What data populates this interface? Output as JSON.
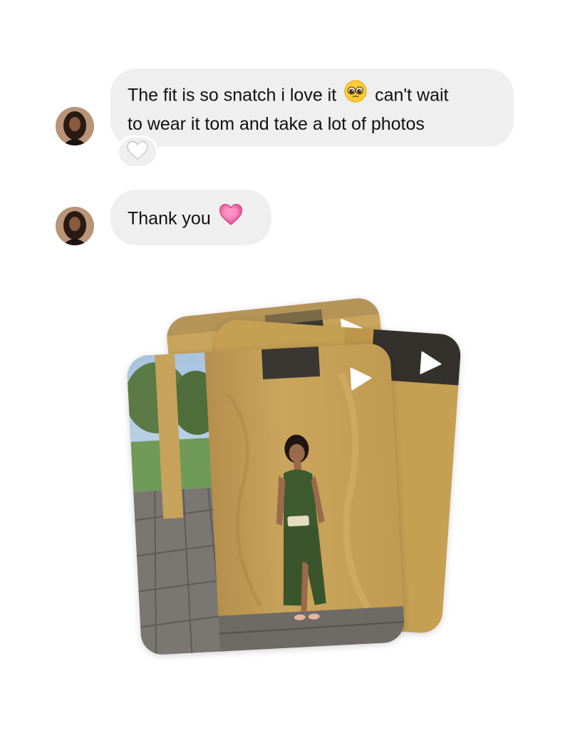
{
  "thread": {
    "messages": [
      {
        "sender": "contact",
        "line1_before_emoji": "The fit is so snatch i love it ",
        "emoji": "pleading-face-emoji",
        "line1_after_emoji": " can't wait",
        "line2": "to wear it tom and take a lot of photos",
        "reaction": "white-heart-icon"
      },
      {
        "sender": "contact",
        "text_before_emoji": "Thank you ",
        "emoji": "pink-heart-emoji"
      }
    ],
    "media_stack": {
      "type": "video-reel-stack",
      "count_visible": 3
    }
  },
  "colors": {
    "bubble_bg": "#efefef",
    "text": "#111111",
    "wall_ochre": "#c8a35a",
    "dress_green": "#3e5a2f",
    "heart_pink": "#e8559a"
  }
}
